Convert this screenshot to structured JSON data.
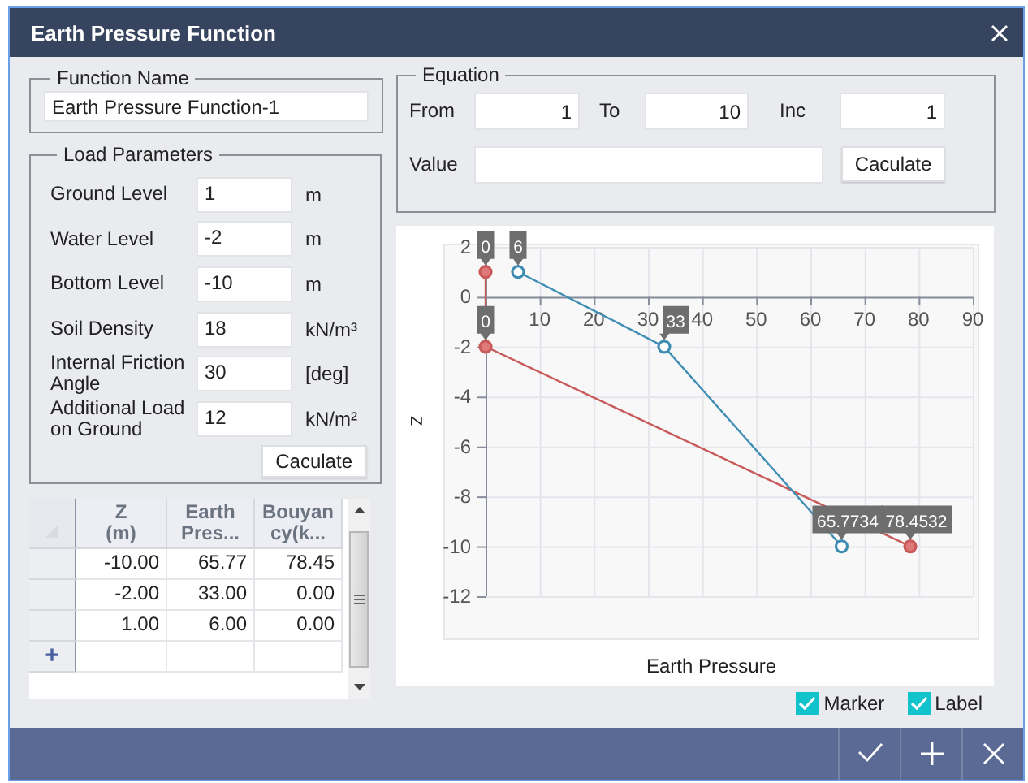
{
  "window": {
    "title": "Earth Pressure Function"
  },
  "function_name": {
    "legend": "Function Name",
    "value": "Earth Pressure Function-1"
  },
  "load_parameters": {
    "legend": "Load Parameters",
    "rows": [
      {
        "label": "Ground Level",
        "value": "1",
        "unit": "m"
      },
      {
        "label": "Water Level",
        "value": "-2",
        "unit": "m"
      },
      {
        "label": "Bottom Level",
        "value": "-10",
        "unit": "m"
      },
      {
        "label": "Soil Density",
        "value": "18",
        "unit": "kN/m³"
      },
      {
        "label": "Internal Friction Angle",
        "value": "30",
        "unit": "[deg]"
      },
      {
        "label": "Additional Load on Ground",
        "value": "12",
        "unit": "kN/m²"
      }
    ],
    "button": "Caculate"
  },
  "table": {
    "columns": [
      {
        "lines": [
          "Z",
          "(m)"
        ]
      },
      {
        "lines": [
          "Earth",
          "Pres..."
        ]
      },
      {
        "lines": [
          "Bouyan",
          "cy(k..."
        ]
      }
    ],
    "rows": [
      [
        "-10.00",
        "65.77",
        "78.45"
      ],
      [
        "-2.00",
        "33.00",
        "0.00"
      ],
      [
        "1.00",
        "6.00",
        "0.00"
      ]
    ],
    "new_row_marker": "+"
  },
  "equation": {
    "legend": "Equation",
    "from_label": "From",
    "from": "1",
    "to_label": "To",
    "to": "10",
    "inc_label": "Inc",
    "inc": "1",
    "value_label": "Value",
    "button": "Caculate"
  },
  "chart": {
    "chart_data": {
      "type": "line",
      "xlabel": "Earth Pressure",
      "ylabel": "Z",
      "xlim": [
        0,
        90
      ],
      "ylim": [
        -12,
        2
      ],
      "xticks": [
        10,
        20,
        30,
        40,
        50,
        60,
        70,
        80,
        90
      ],
      "yticks": [
        2,
        0,
        -2,
        -4,
        -6,
        -8,
        -10,
        -12
      ],
      "grid": true,
      "orientation": "horizontal",
      "data_labels": true,
      "series": [
        {
          "color": "#c85a5a",
          "marker": "circle",
          "x": [
            1,
            -2,
            -10
          ],
          "values": [
            0,
            0,
            78.4532
          ]
        },
        {
          "color": "#3f8db3",
          "marker": "circle",
          "x": [
            1,
            -2,
            -10
          ],
          "values": [
            6,
            33,
            65.7734
          ]
        }
      ]
    }
  },
  "options": [
    {
      "label": "Marker",
      "checked": true
    },
    {
      "label": "Label",
      "checked": true
    }
  ],
  "footer_buttons": [
    {
      "kind": "ok"
    },
    {
      "kind": "add"
    },
    {
      "kind": "close"
    }
  ]
}
